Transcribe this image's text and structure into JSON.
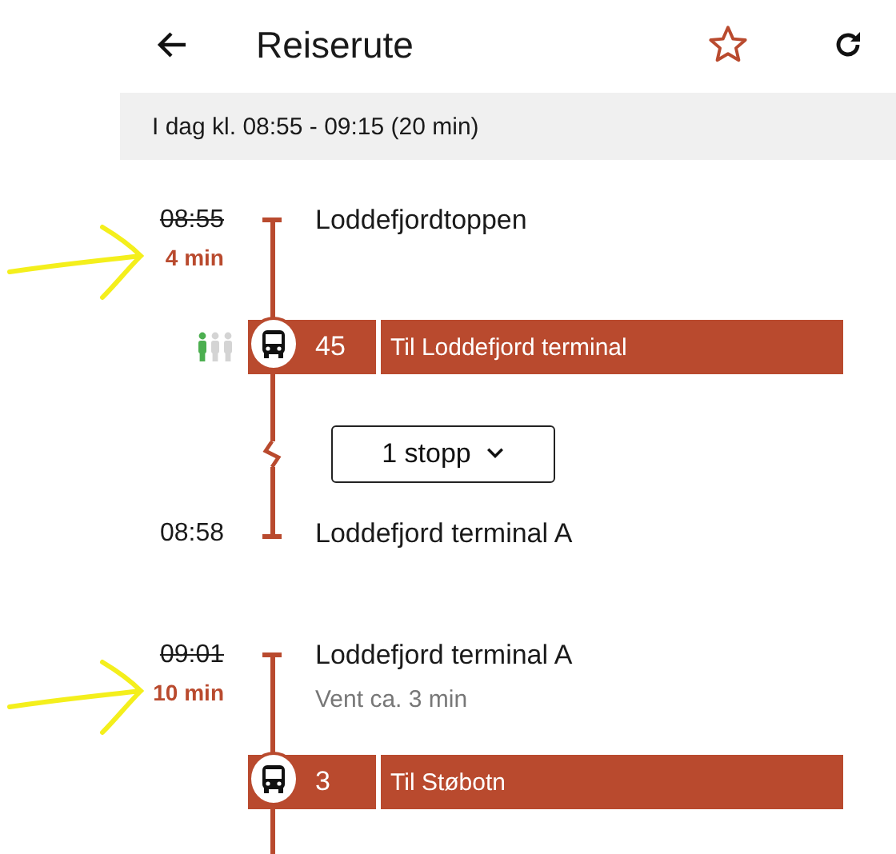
{
  "header": {
    "title": "Reiserute",
    "favorite": false
  },
  "summary": "I dag kl. 08:55 - 09:15 (20 min)",
  "itinerary": [
    {
      "kind": "departure",
      "time": "08:55",
      "time_struck": true,
      "delay": "4 min",
      "name": "Loddefjordtoppen",
      "arrow_marked": true
    },
    {
      "kind": "leg",
      "occupancy": {
        "kind": "low"
      },
      "line": "45",
      "destination": "Til Loddefjord terminal"
    },
    {
      "kind": "toggle",
      "label": "1 stopp",
      "expanded": false
    },
    {
      "kind": "arrival",
      "time": "08:58",
      "time_struck": false,
      "name": "Loddefjord terminal A",
      "arrow_marked": false
    },
    {
      "kind": "departure",
      "time": "09:01",
      "time_struck": true,
      "delay": "10 min",
      "name": "Loddefjord terminal A",
      "note": "Vent ca. 3 min",
      "arrow_marked": true
    },
    {
      "kind": "leg",
      "line": "3",
      "destination": "Til Støbotn"
    }
  ]
}
